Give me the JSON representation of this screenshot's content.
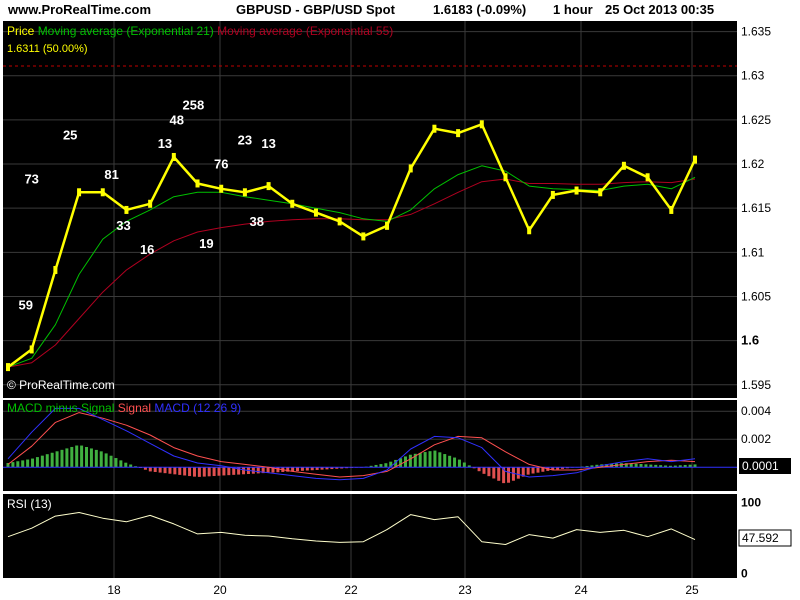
{
  "header": {
    "site": "www.ProRealTime.com",
    "symbol": "GBPUSD - GBP/USD Spot",
    "quote": "1.6183 (-0.09%)",
    "period": "1 hour",
    "datetime": "25 Oct 2013 00:35"
  },
  "watermark": "© ProRealTime.com",
  "colors": {
    "background": "#000000",
    "price": "#ffff00",
    "ema21": "#00c000",
    "ema55": "#b00020",
    "macd_hist_pos": "#40b040",
    "macd_hist_neg": "#e05050",
    "signal": "#ff5050",
    "macd": "#3030ff",
    "rsi": "#ffffcc",
    "fib": "#c00000"
  },
  "chart_data": [
    {
      "type": "line",
      "panel": "price",
      "legend": {
        "price": "Price",
        "ema21": "Moving average (Exponential 21)",
        "ema55": "Moving average (Exponential 55)"
      },
      "level_label": "1.6311 (50.00%)",
      "level": 1.6311,
      "ylim": [
        1.5935,
        1.6362
      ],
      "y_ticks": [
        "1.635",
        "1.63",
        "1.625",
        "1.62",
        "1.615",
        "1.61",
        "1.605",
        "1.6",
        "1.595"
      ],
      "x_ticks": [
        "18",
        "20",
        "22",
        "23",
        "24",
        "25"
      ],
      "x": [
        0,
        4,
        8,
        12,
        16,
        20,
        24,
        28,
        32,
        36,
        40,
        44,
        48,
        52,
        56,
        60,
        64,
        68,
        72,
        76,
        80,
        84,
        88,
        92,
        96,
        100,
        104,
        108,
        112,
        116
      ],
      "series": [
        {
          "key": "price",
          "values": [
            1.597,
            1.599,
            1.608,
            1.6168,
            1.6168,
            1.6148,
            1.6155,
            1.6208,
            1.6178,
            1.6172,
            1.6168,
            1.6175,
            1.6155,
            1.6145,
            1.6135,
            1.6118,
            1.613,
            1.6195,
            1.624,
            1.6235,
            1.6245,
            1.6185,
            1.6125,
            1.6165,
            1.617,
            1.6168,
            1.6198,
            1.6185,
            1.6148,
            1.6205
          ]
        },
        {
          "key": "ema21",
          "values": [
            1.597,
            1.598,
            1.6018,
            1.6075,
            1.6115,
            1.6135,
            1.6148,
            1.6163,
            1.6168,
            1.6168,
            1.6163,
            1.6159,
            1.6155,
            1.615,
            1.6145,
            1.6138,
            1.6135,
            1.6148,
            1.6172,
            1.6188,
            1.6198,
            1.6192,
            1.6175,
            1.6172,
            1.6171,
            1.617,
            1.6175,
            1.6177,
            1.6172,
            1.6185
          ]
        },
        {
          "key": "ema55",
          "values": [
            1.597,
            1.5975,
            1.5995,
            1.6025,
            1.6055,
            1.608,
            1.6098,
            1.6113,
            1.6123,
            1.6128,
            1.6132,
            1.6135,
            1.6137,
            1.6138,
            1.6138,
            1.6137,
            1.6137,
            1.6143,
            1.6155,
            1.6168,
            1.618,
            1.6183,
            1.6178,
            1.6178,
            1.6177,
            1.6177,
            1.6179,
            1.618,
            1.6179,
            1.6183
          ]
        }
      ],
      "annotations": [
        {
          "text": "59",
          "x": 3,
          "y": 1.6035
        },
        {
          "text": "73",
          "x": 4,
          "y": 1.6178
        },
        {
          "text": "25",
          "x": 10.5,
          "y": 1.6228
        },
        {
          "text": "81",
          "x": 17.5,
          "y": 1.6183
        },
        {
          "text": "33",
          "x": 19.5,
          "y": 1.6125
        },
        {
          "text": "16",
          "x": 23.5,
          "y": 1.6098
        },
        {
          "text": "13",
          "x": 26.5,
          "y": 1.6218
        },
        {
          "text": "48",
          "x": 28.5,
          "y": 1.6245
        },
        {
          "text": "258",
          "x": 31.3,
          "y": 1.6262
        },
        {
          "text": "19",
          "x": 33.5,
          "y": 1.6105
        },
        {
          "text": "76",
          "x": 36,
          "y": 1.6195
        },
        {
          "text": "23",
          "x": 40,
          "y": 1.6222
        },
        {
          "text": "38",
          "x": 42,
          "y": 1.613
        },
        {
          "text": "13",
          "x": 44,
          "y": 1.6218
        }
      ]
    },
    {
      "type": "bar",
      "panel": "macd",
      "legend": {
        "hist": "MACD minus Signal",
        "signal": "Signal",
        "macd": "MACD (12 26 9)"
      },
      "ylim": [
        -0.0017,
        0.0048
      ],
      "y_ticks": [
        "0.004",
        "0.002"
      ],
      "last_value_label": "0.0001",
      "x": [
        0,
        4,
        8,
        12,
        16,
        20,
        24,
        28,
        32,
        36,
        40,
        44,
        48,
        52,
        56,
        60,
        64,
        68,
        72,
        76,
        80,
        84,
        88,
        92,
        96,
        100,
        104,
        108,
        112,
        116
      ],
      "series": [
        {
          "key": "hist",
          "values": [
            0.0003,
            0.0006,
            0.0011,
            0.0016,
            0.0011,
            0.0003,
            -0.0003,
            -0.0005,
            -0.0007,
            -0.0006,
            -0.0005,
            -0.0004,
            -0.0003,
            -0.0002,
            -0.0001,
            0.0,
            0.0003,
            0.0009,
            0.0012,
            0.0006,
            -0.0004,
            -0.0012,
            -0.0005,
            -0.0002,
            0.0,
            0.0002,
            0.0003,
            0.0002,
            0.0001,
            0.0002
          ]
        },
        {
          "key": "signal",
          "values": [
            0.0002,
            0.0015,
            0.0032,
            0.0039,
            0.0035,
            0.003,
            0.0023,
            0.0014,
            0.0008,
            0.0004,
            0.0002,
            0.0,
            -0.0003,
            -0.0005,
            -0.0007,
            -0.0006,
            -0.0003,
            0.0006,
            0.0016,
            0.0022,
            0.0021,
            0.0011,
            0.0002,
            -0.0002,
            -0.0002,
            0.0,
            0.0002,
            0.0004,
            0.0005,
            0.0004
          ]
        },
        {
          "key": "macd",
          "values": [
            0.0006,
            0.0025,
            0.0042,
            0.0042,
            0.0034,
            0.0026,
            0.0017,
            0.0008,
            0.0003,
            0.0001,
            -0.0002,
            -0.0004,
            -0.0006,
            -0.0008,
            -0.0009,
            -0.0008,
            -0.0002,
            0.0013,
            0.0022,
            0.0021,
            0.0014,
            -0.0003,
            -0.0007,
            -0.0006,
            -0.0004,
            0.0001,
            0.0004,
            0.0006,
            0.0004,
            0.0006
          ]
        }
      ]
    },
    {
      "type": "line",
      "panel": "rsi",
      "legend": {
        "rsi": "RSI (13)"
      },
      "ylim": [
        -6,
        112
      ],
      "y_ticks": [
        "100",
        "0"
      ],
      "last_value_label": "47.592",
      "x": [
        0,
        4,
        8,
        12,
        16,
        20,
        24,
        28,
        32,
        36,
        40,
        44,
        48,
        52,
        56,
        60,
        64,
        68,
        72,
        76,
        80,
        84,
        88,
        92,
        96,
        100,
        104,
        108,
        112,
        116
      ],
      "series": [
        {
          "key": "rsi",
          "values": [
            52,
            64,
            81,
            86,
            78,
            73,
            82,
            70,
            56,
            58,
            54,
            53,
            49,
            46,
            44,
            45,
            62,
            83,
            76,
            80,
            45,
            41,
            55,
            50,
            62,
            58,
            61,
            52,
            63,
            48
          ]
        }
      ]
    }
  ]
}
